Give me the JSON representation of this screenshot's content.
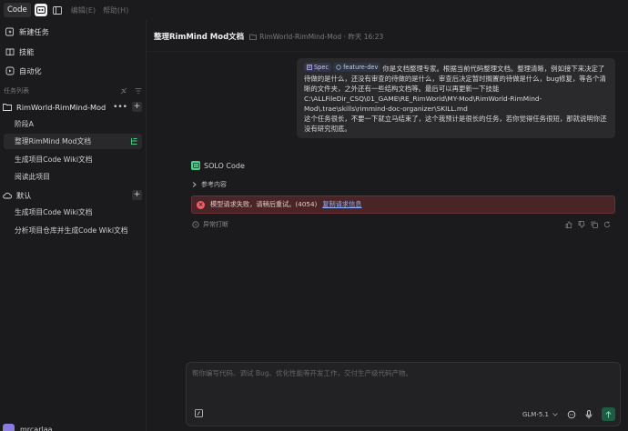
{
  "topbar": {
    "mode_code": "Code",
    "menu_edit": "编辑(E)",
    "menu_help": "帮助(H)"
  },
  "sidebar": {
    "nav": [
      {
        "label": "新建任务",
        "icon": "new-task-icon"
      },
      {
        "label": "技能",
        "icon": "book-icon"
      },
      {
        "label": "自动化",
        "icon": "automation-icon"
      }
    ],
    "section_label": "任务列表",
    "projects": [
      {
        "name": "RimWorld-RimMind-Mod",
        "tasks": [
          "阶段A",
          "整理RimMind Mod文档",
          "生成项目Code Wiki文档",
          "阅读此项目"
        ]
      },
      {
        "name": "默认",
        "tasks": [
          "生成项目Code Wiki文档",
          "分析项目仓库并生成Code Wiki文档"
        ]
      }
    ],
    "user": "mrcarlaa"
  },
  "header": {
    "title": "整理RimMind Mod文档",
    "path": "RimWorld-RimMind-Mod · 昨天 16:23"
  },
  "message": {
    "chip_spec": "Spec",
    "chip_dev": "feature-dev",
    "text": "你是文档整理专家。根据当前代码整理文档。整理清晰，例如接下来决定了待做的是什么，还没有审查的待做的是什么，审查后决定暂时搁置的待做是什么，bug修复，等各个清晰的文件夹，之外还有一些结构文档等。最后可以再更新一下技能 C:\\ALLFileDir_CSQ\\01_GAME\\RE_RimWorld\\MY-Mod\\RimWorld-RimMind-Mod\\.trae\\skills\\rimmind-doc-organizer\\SKILL.md",
    "text2": "这个任务很长，不要一下就立马结束了，这个我预计是很长的任务，若你觉得任务很短，那就说明你还没有研究彻底。"
  },
  "agent": {
    "name": "SOLO Code",
    "reference": "参考内容",
    "error_text": "模型请求失败，请稍后重试。(4054)",
    "error_link": "复制请求信息",
    "status": "异常打断"
  },
  "input": {
    "placeholder": "帮你编写代码、调试 Bug、优化性能等开发工作，交付生产级代码产物。",
    "model": "GLM-5.1"
  }
}
